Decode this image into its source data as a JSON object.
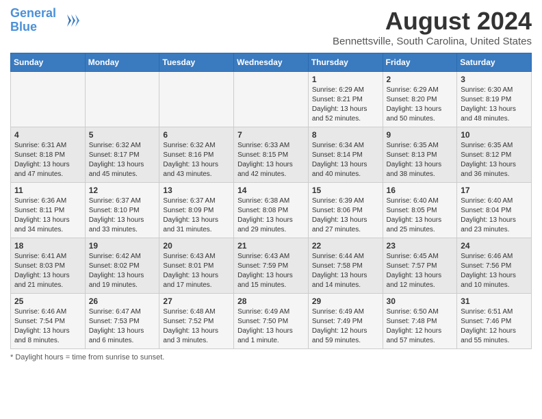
{
  "logo": {
    "line1": "General",
    "line2": "Blue"
  },
  "title": "August 2024",
  "location": "Bennettsville, South Carolina, United States",
  "weekdays": [
    "Sunday",
    "Monday",
    "Tuesday",
    "Wednesday",
    "Thursday",
    "Friday",
    "Saturday"
  ],
  "weeks": [
    [
      {
        "day": "",
        "info": ""
      },
      {
        "day": "",
        "info": ""
      },
      {
        "day": "",
        "info": ""
      },
      {
        "day": "",
        "info": ""
      },
      {
        "day": "1",
        "info": "Sunrise: 6:29 AM\nSunset: 8:21 PM\nDaylight: 13 hours\nand 52 minutes."
      },
      {
        "day": "2",
        "info": "Sunrise: 6:29 AM\nSunset: 8:20 PM\nDaylight: 13 hours\nand 50 minutes."
      },
      {
        "day": "3",
        "info": "Sunrise: 6:30 AM\nSunset: 8:19 PM\nDaylight: 13 hours\nand 48 minutes."
      }
    ],
    [
      {
        "day": "4",
        "info": "Sunrise: 6:31 AM\nSunset: 8:18 PM\nDaylight: 13 hours\nand 47 minutes."
      },
      {
        "day": "5",
        "info": "Sunrise: 6:32 AM\nSunset: 8:17 PM\nDaylight: 13 hours\nand 45 minutes."
      },
      {
        "day": "6",
        "info": "Sunrise: 6:32 AM\nSunset: 8:16 PM\nDaylight: 13 hours\nand 43 minutes."
      },
      {
        "day": "7",
        "info": "Sunrise: 6:33 AM\nSunset: 8:15 PM\nDaylight: 13 hours\nand 42 minutes."
      },
      {
        "day": "8",
        "info": "Sunrise: 6:34 AM\nSunset: 8:14 PM\nDaylight: 13 hours\nand 40 minutes."
      },
      {
        "day": "9",
        "info": "Sunrise: 6:35 AM\nSunset: 8:13 PM\nDaylight: 13 hours\nand 38 minutes."
      },
      {
        "day": "10",
        "info": "Sunrise: 6:35 AM\nSunset: 8:12 PM\nDaylight: 13 hours\nand 36 minutes."
      }
    ],
    [
      {
        "day": "11",
        "info": "Sunrise: 6:36 AM\nSunset: 8:11 PM\nDaylight: 13 hours\nand 34 minutes."
      },
      {
        "day": "12",
        "info": "Sunrise: 6:37 AM\nSunset: 8:10 PM\nDaylight: 13 hours\nand 33 minutes."
      },
      {
        "day": "13",
        "info": "Sunrise: 6:37 AM\nSunset: 8:09 PM\nDaylight: 13 hours\nand 31 minutes."
      },
      {
        "day": "14",
        "info": "Sunrise: 6:38 AM\nSunset: 8:08 PM\nDaylight: 13 hours\nand 29 minutes."
      },
      {
        "day": "15",
        "info": "Sunrise: 6:39 AM\nSunset: 8:06 PM\nDaylight: 13 hours\nand 27 minutes."
      },
      {
        "day": "16",
        "info": "Sunrise: 6:40 AM\nSunset: 8:05 PM\nDaylight: 13 hours\nand 25 minutes."
      },
      {
        "day": "17",
        "info": "Sunrise: 6:40 AM\nSunset: 8:04 PM\nDaylight: 13 hours\nand 23 minutes."
      }
    ],
    [
      {
        "day": "18",
        "info": "Sunrise: 6:41 AM\nSunset: 8:03 PM\nDaylight: 13 hours\nand 21 minutes."
      },
      {
        "day": "19",
        "info": "Sunrise: 6:42 AM\nSunset: 8:02 PM\nDaylight: 13 hours\nand 19 minutes."
      },
      {
        "day": "20",
        "info": "Sunrise: 6:43 AM\nSunset: 8:01 PM\nDaylight: 13 hours\nand 17 minutes."
      },
      {
        "day": "21",
        "info": "Sunrise: 6:43 AM\nSunset: 7:59 PM\nDaylight: 13 hours\nand 15 minutes."
      },
      {
        "day": "22",
        "info": "Sunrise: 6:44 AM\nSunset: 7:58 PM\nDaylight: 13 hours\nand 14 minutes."
      },
      {
        "day": "23",
        "info": "Sunrise: 6:45 AM\nSunset: 7:57 PM\nDaylight: 13 hours\nand 12 minutes."
      },
      {
        "day": "24",
        "info": "Sunrise: 6:46 AM\nSunset: 7:56 PM\nDaylight: 13 hours\nand 10 minutes."
      }
    ],
    [
      {
        "day": "25",
        "info": "Sunrise: 6:46 AM\nSunset: 7:54 PM\nDaylight: 13 hours\nand 8 minutes."
      },
      {
        "day": "26",
        "info": "Sunrise: 6:47 AM\nSunset: 7:53 PM\nDaylight: 13 hours\nand 6 minutes."
      },
      {
        "day": "27",
        "info": "Sunrise: 6:48 AM\nSunset: 7:52 PM\nDaylight: 13 hours\nand 3 minutes."
      },
      {
        "day": "28",
        "info": "Sunrise: 6:49 AM\nSunset: 7:50 PM\nDaylight: 13 hours\nand 1 minute."
      },
      {
        "day": "29",
        "info": "Sunrise: 6:49 AM\nSunset: 7:49 PM\nDaylight: 12 hours\nand 59 minutes."
      },
      {
        "day": "30",
        "info": "Sunrise: 6:50 AM\nSunset: 7:48 PM\nDaylight: 12 hours\nand 57 minutes."
      },
      {
        "day": "31",
        "info": "Sunrise: 6:51 AM\nSunset: 7:46 PM\nDaylight: 12 hours\nand 55 minutes."
      }
    ]
  ],
  "footer": "Daylight hours"
}
